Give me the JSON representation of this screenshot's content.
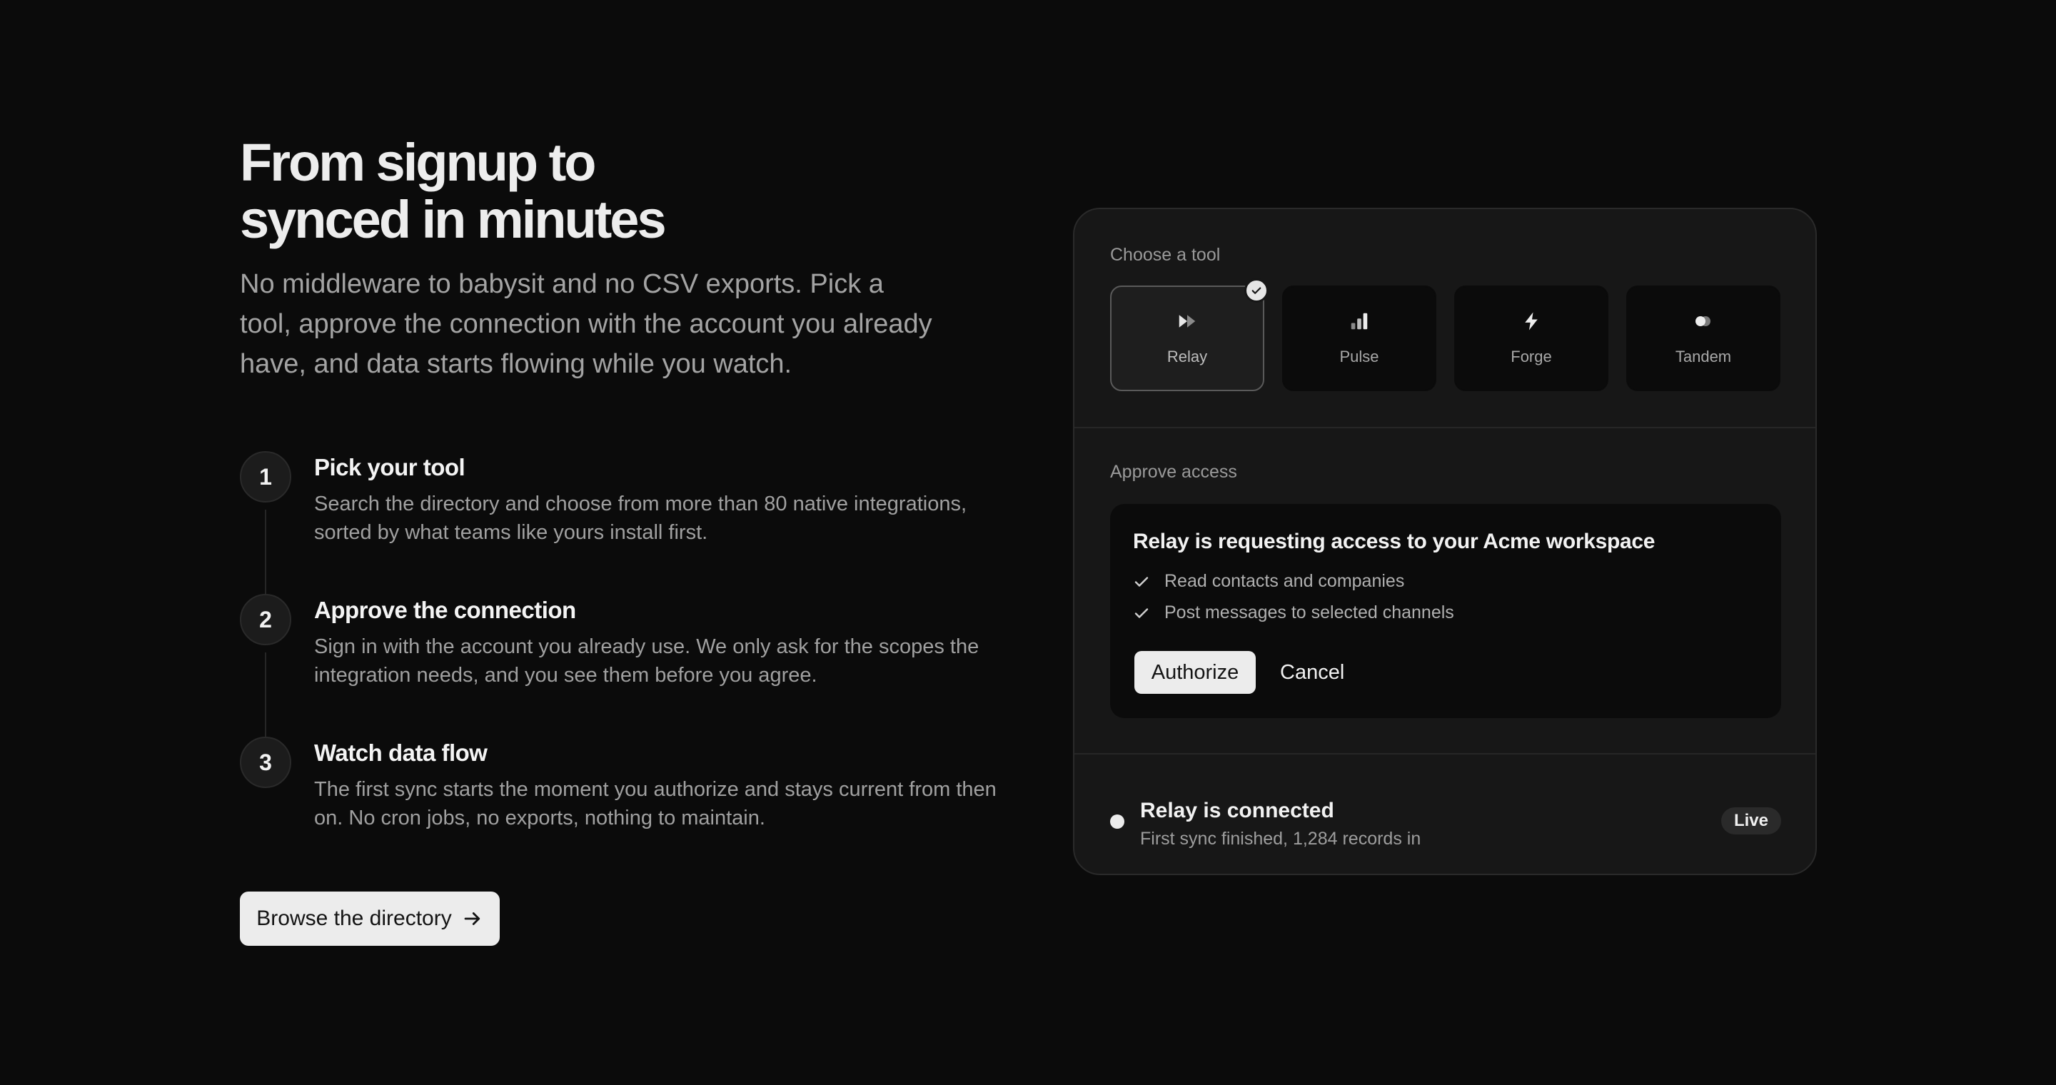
{
  "hero": {
    "title_line1": "From signup to",
    "title_line2": "synced in minutes",
    "subtitle": "No middleware to babysit and no CSV exports. Pick a tool, approve the connection with the account you already have, and data starts flowing while you watch."
  },
  "steps": [
    {
      "number": "1",
      "title": "Pick your tool",
      "description": "Search the directory and choose from more than 80 native integrations, sorted by what teams like yours install first."
    },
    {
      "number": "2",
      "title": "Approve the connection",
      "description": "Sign in with the account you already use. We only ask for the scopes the integration needs, and you see them before you agree."
    },
    {
      "number": "3",
      "title": "Watch data flow",
      "description": "The first sync starts the moment you authorize and stays current from then on. No cron jobs, no exports, nothing to maintain."
    }
  ],
  "cta": {
    "label": "Browse the directory",
    "icon": "arrow-right-icon"
  },
  "panel": {
    "choose_label": "Choose a tool",
    "tools": [
      {
        "label": "Relay",
        "icon": "fast-forward-icon",
        "selected": true
      },
      {
        "label": "Pulse",
        "icon": "bar-chart-icon",
        "selected": false
      },
      {
        "label": "Forge",
        "icon": "lightning-icon",
        "selected": false
      },
      {
        "label": "Tandem",
        "icon": "toggle-icon",
        "selected": false
      }
    ],
    "approve_label": "Approve access",
    "auth": {
      "title": "Relay is requesting access to your Acme workspace",
      "scopes": [
        "Read contacts and companies",
        "Post messages to selected channels"
      ],
      "authorize_label": "Authorize",
      "cancel_label": "Cancel"
    },
    "status": {
      "title": "Relay is connected",
      "subtitle": "First sync finished, 1,284 records in",
      "badge": "Live"
    }
  },
  "colors": {
    "background": "#0b0b0b",
    "panel": "#171717",
    "accent_light": "#ececec",
    "muted_text": "#a3a3a3"
  }
}
